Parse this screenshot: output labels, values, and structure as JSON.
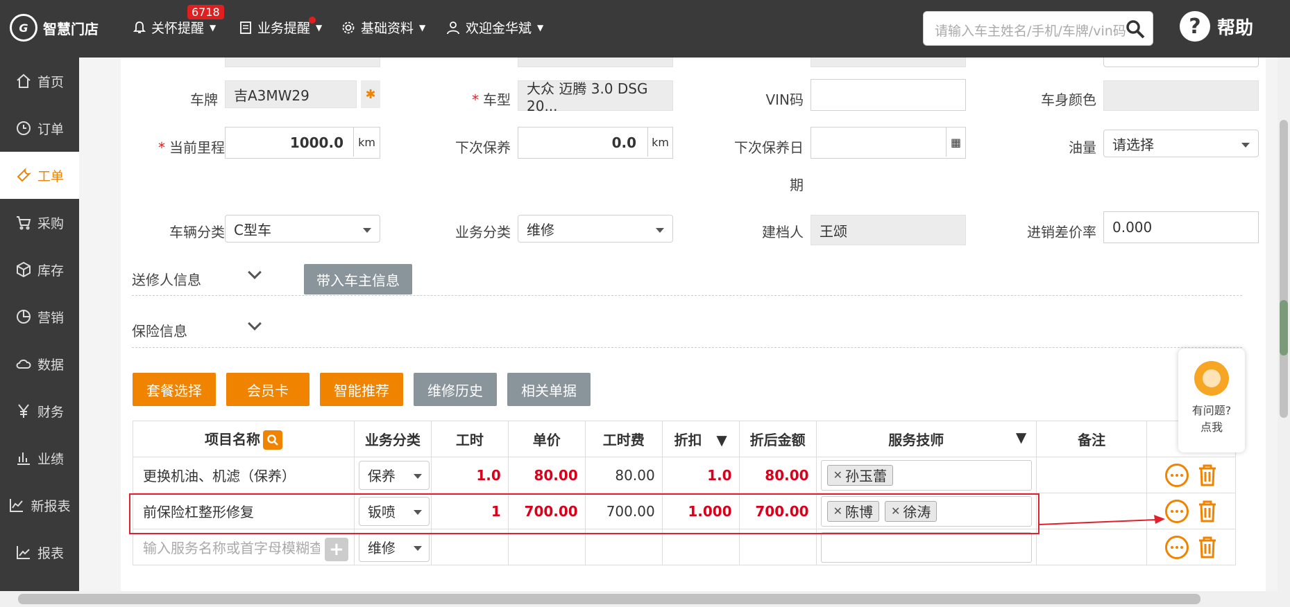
{
  "header": {
    "logo_text": "智慧门店",
    "nav": [
      {
        "label": "关怀提醒",
        "icon": "bell-icon"
      },
      {
        "label": "业务提醒",
        "icon": "document-icon"
      },
      {
        "label": "基础资料",
        "icon": "gear-icon"
      },
      {
        "label": "欢迎金华斌",
        "icon": "user-icon"
      }
    ],
    "badge_count": "6718",
    "search_placeholder": "请输入车主姓名/手机/车牌/vin码",
    "help_label": "帮助"
  },
  "sidebar": {
    "items": [
      {
        "label": "首页",
        "icon": "home-icon"
      },
      {
        "label": "订单",
        "icon": "clock-icon"
      },
      {
        "label": "工单",
        "icon": "wrench-icon",
        "active": true
      },
      {
        "label": "采购",
        "icon": "cart-icon"
      },
      {
        "label": "库存",
        "icon": "box-icon"
      },
      {
        "label": "营销",
        "icon": "pie-icon"
      },
      {
        "label": "数据",
        "icon": "cloud-icon"
      },
      {
        "label": "财务",
        "icon": "yen-icon"
      },
      {
        "label": "业绩",
        "icon": "bar-chart-icon"
      },
      {
        "label": "新报表",
        "icon": "line-chart-icon"
      },
      {
        "label": "报表",
        "icon": "trend-icon"
      }
    ]
  },
  "form": {
    "plate_label": "车牌",
    "plate_value": "吉A3MW29",
    "model_label": "车型",
    "model_value": "大众 迈腾 3.0 DSG 20...",
    "vin_label": "VIN码",
    "vin_value": "",
    "color_label": "车身颜色",
    "color_value": "",
    "mileage_label": "当前里程",
    "mileage_value": "1000.0",
    "mileage_unit": "km",
    "next_maint_label": "下次保养",
    "next_maint_value": "0.0",
    "next_maint_unit": "km",
    "next_date_label": "下次保养日",
    "next_date_label_2": "期",
    "next_date_value": "",
    "fuel_label": "油量",
    "fuel_value": "请选择",
    "vehicle_class_label": "车辆分类",
    "vehicle_class_value": "C型车",
    "biz_class_label": "业务分类",
    "biz_class_value": "维修",
    "creator_label": "建档人",
    "creator_value": "王颂",
    "margin_label": "进销差价率",
    "margin_value": "0.000"
  },
  "sections": {
    "sender_title": "送修人信息",
    "bring_owner_btn": "带入车主信息",
    "insurance_title": "保险信息"
  },
  "actions": [
    "套餐选择",
    "会员卡",
    "智能推荐",
    "维修历史",
    "相关单据"
  ],
  "table": {
    "headers": {
      "name": "项目名称",
      "biz": "业务分类",
      "hours": "工时",
      "price": "单价",
      "fee": "工时费",
      "discount": "折扣",
      "amount": "折后金额",
      "tech": "服务技师",
      "remark": "备注"
    },
    "rows": [
      {
        "name": "更换机油、机滤（保养）",
        "biz": "保养",
        "hours": "1.0",
        "price": "80.00",
        "fee": "80.00",
        "discount": "1.0",
        "amount": "80.00",
        "techs": [
          "孙玉蕾"
        ]
      },
      {
        "name": "前保险杠整形修复",
        "biz": "钣喷",
        "hours": "1",
        "price": "700.00",
        "fee": "700.00",
        "discount": "1.000",
        "amount": "700.00",
        "techs": [
          "陈博",
          "徐涛"
        ]
      }
    ],
    "new_row_placeholder": "输入服务名称或首字母模糊查询",
    "new_row_biz": "维修"
  },
  "float_help": {
    "line1": "有问题?",
    "line2": "点我"
  },
  "colors": {
    "accent": "#f08300",
    "dark": "#3a3a3a",
    "annotation": "#e0202a"
  }
}
